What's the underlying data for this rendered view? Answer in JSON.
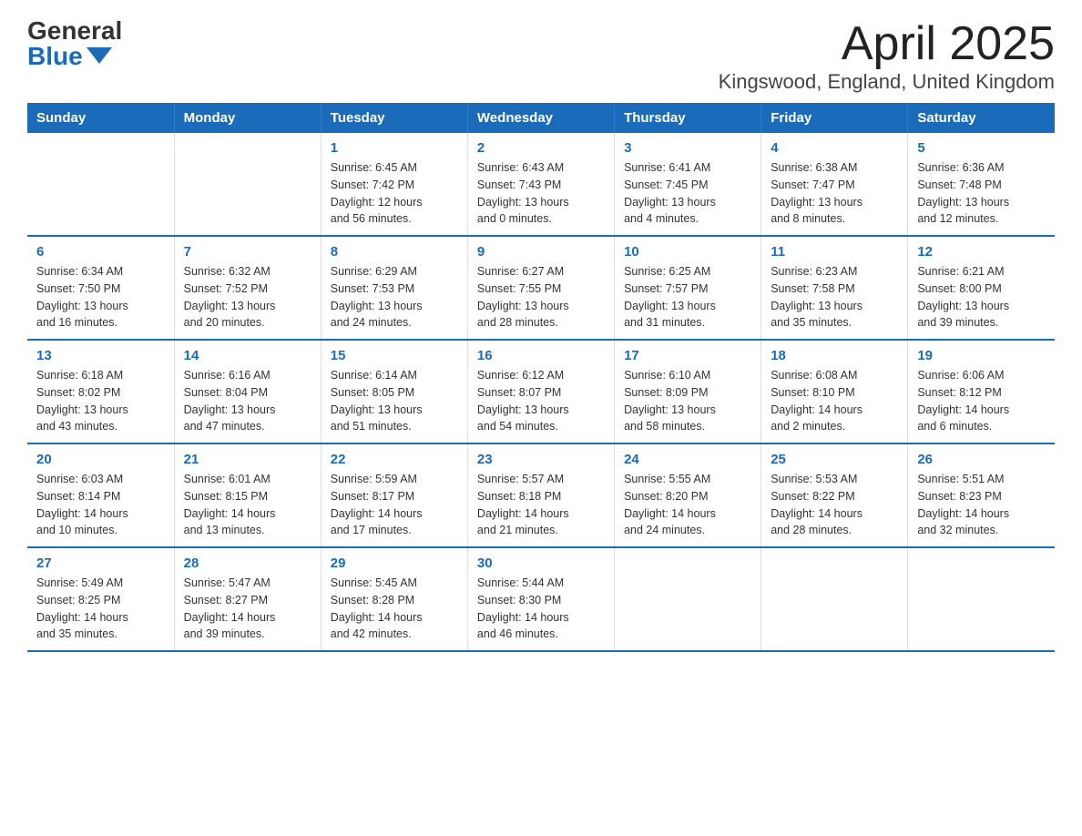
{
  "logo": {
    "general": "General",
    "blue": "Blue"
  },
  "title": "April 2025",
  "subtitle": "Kingswood, England, United Kingdom",
  "days_of_week": [
    "Sunday",
    "Monday",
    "Tuesday",
    "Wednesday",
    "Thursday",
    "Friday",
    "Saturday"
  ],
  "weeks": [
    [
      {
        "day": "",
        "info": ""
      },
      {
        "day": "",
        "info": ""
      },
      {
        "day": "1",
        "info": "Sunrise: 6:45 AM\nSunset: 7:42 PM\nDaylight: 12 hours\nand 56 minutes."
      },
      {
        "day": "2",
        "info": "Sunrise: 6:43 AM\nSunset: 7:43 PM\nDaylight: 13 hours\nand 0 minutes."
      },
      {
        "day": "3",
        "info": "Sunrise: 6:41 AM\nSunset: 7:45 PM\nDaylight: 13 hours\nand 4 minutes."
      },
      {
        "day": "4",
        "info": "Sunrise: 6:38 AM\nSunset: 7:47 PM\nDaylight: 13 hours\nand 8 minutes."
      },
      {
        "day": "5",
        "info": "Sunrise: 6:36 AM\nSunset: 7:48 PM\nDaylight: 13 hours\nand 12 minutes."
      }
    ],
    [
      {
        "day": "6",
        "info": "Sunrise: 6:34 AM\nSunset: 7:50 PM\nDaylight: 13 hours\nand 16 minutes."
      },
      {
        "day": "7",
        "info": "Sunrise: 6:32 AM\nSunset: 7:52 PM\nDaylight: 13 hours\nand 20 minutes."
      },
      {
        "day": "8",
        "info": "Sunrise: 6:29 AM\nSunset: 7:53 PM\nDaylight: 13 hours\nand 24 minutes."
      },
      {
        "day": "9",
        "info": "Sunrise: 6:27 AM\nSunset: 7:55 PM\nDaylight: 13 hours\nand 28 minutes."
      },
      {
        "day": "10",
        "info": "Sunrise: 6:25 AM\nSunset: 7:57 PM\nDaylight: 13 hours\nand 31 minutes."
      },
      {
        "day": "11",
        "info": "Sunrise: 6:23 AM\nSunset: 7:58 PM\nDaylight: 13 hours\nand 35 minutes."
      },
      {
        "day": "12",
        "info": "Sunrise: 6:21 AM\nSunset: 8:00 PM\nDaylight: 13 hours\nand 39 minutes."
      }
    ],
    [
      {
        "day": "13",
        "info": "Sunrise: 6:18 AM\nSunset: 8:02 PM\nDaylight: 13 hours\nand 43 minutes."
      },
      {
        "day": "14",
        "info": "Sunrise: 6:16 AM\nSunset: 8:04 PM\nDaylight: 13 hours\nand 47 minutes."
      },
      {
        "day": "15",
        "info": "Sunrise: 6:14 AM\nSunset: 8:05 PM\nDaylight: 13 hours\nand 51 minutes."
      },
      {
        "day": "16",
        "info": "Sunrise: 6:12 AM\nSunset: 8:07 PM\nDaylight: 13 hours\nand 54 minutes."
      },
      {
        "day": "17",
        "info": "Sunrise: 6:10 AM\nSunset: 8:09 PM\nDaylight: 13 hours\nand 58 minutes."
      },
      {
        "day": "18",
        "info": "Sunrise: 6:08 AM\nSunset: 8:10 PM\nDaylight: 14 hours\nand 2 minutes."
      },
      {
        "day": "19",
        "info": "Sunrise: 6:06 AM\nSunset: 8:12 PM\nDaylight: 14 hours\nand 6 minutes."
      }
    ],
    [
      {
        "day": "20",
        "info": "Sunrise: 6:03 AM\nSunset: 8:14 PM\nDaylight: 14 hours\nand 10 minutes."
      },
      {
        "day": "21",
        "info": "Sunrise: 6:01 AM\nSunset: 8:15 PM\nDaylight: 14 hours\nand 13 minutes."
      },
      {
        "day": "22",
        "info": "Sunrise: 5:59 AM\nSunset: 8:17 PM\nDaylight: 14 hours\nand 17 minutes."
      },
      {
        "day": "23",
        "info": "Sunrise: 5:57 AM\nSunset: 8:18 PM\nDaylight: 14 hours\nand 21 minutes."
      },
      {
        "day": "24",
        "info": "Sunrise: 5:55 AM\nSunset: 8:20 PM\nDaylight: 14 hours\nand 24 minutes."
      },
      {
        "day": "25",
        "info": "Sunrise: 5:53 AM\nSunset: 8:22 PM\nDaylight: 14 hours\nand 28 minutes."
      },
      {
        "day": "26",
        "info": "Sunrise: 5:51 AM\nSunset: 8:23 PM\nDaylight: 14 hours\nand 32 minutes."
      }
    ],
    [
      {
        "day": "27",
        "info": "Sunrise: 5:49 AM\nSunset: 8:25 PM\nDaylight: 14 hours\nand 35 minutes."
      },
      {
        "day": "28",
        "info": "Sunrise: 5:47 AM\nSunset: 8:27 PM\nDaylight: 14 hours\nand 39 minutes."
      },
      {
        "day": "29",
        "info": "Sunrise: 5:45 AM\nSunset: 8:28 PM\nDaylight: 14 hours\nand 42 minutes."
      },
      {
        "day": "30",
        "info": "Sunrise: 5:44 AM\nSunset: 8:30 PM\nDaylight: 14 hours\nand 46 minutes."
      },
      {
        "day": "",
        "info": ""
      },
      {
        "day": "",
        "info": ""
      },
      {
        "day": "",
        "info": ""
      }
    ]
  ]
}
